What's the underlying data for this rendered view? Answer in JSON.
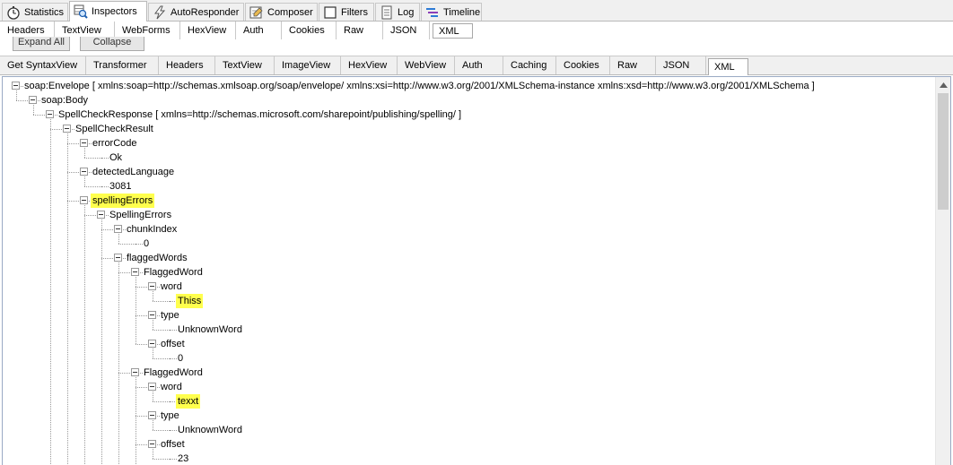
{
  "main_tabs": [
    {
      "label": "Statistics",
      "icon": "stopwatch-icon"
    },
    {
      "label": "Inspectors",
      "icon": "magnifier-grid-icon",
      "active": true
    },
    {
      "label": "AutoResponder",
      "icon": "lightning-icon"
    },
    {
      "label": "Composer",
      "icon": "edit-form-icon"
    },
    {
      "label": "Filters",
      "icon": "checkbox-icon"
    },
    {
      "label": "Log",
      "icon": "document-icon"
    },
    {
      "label": "Timeline",
      "icon": "timeline-bars-icon"
    }
  ],
  "request_tabs": [
    "Headers",
    "TextView",
    "WebForms",
    "HexView",
    "Auth",
    "Cookies",
    "Raw",
    "JSON",
    "XML"
  ],
  "request_active": "XML",
  "request_buttons": {
    "expand_all": "Expand All",
    "collapse": "Collapse"
  },
  "response_tabs": [
    "Get SyntaxView",
    "Transformer",
    "Headers",
    "TextView",
    "ImageView",
    "HexView",
    "WebView",
    "Auth",
    "Caching",
    "Cookies",
    "Raw",
    "JSON",
    "XML"
  ],
  "response_active": "XML",
  "tree": [
    {
      "text": "soap:Envelope [ xmlns:soap=http://schemas.xmlsoap.org/soap/envelope/ xmlns:xsi=http://www.w3.org/2001/XMLSchema-instance xmlns:xsd=http://www.w3.org/2001/XMLSchema ]",
      "depth": 0,
      "expandable": true
    },
    {
      "text": "soap:Body",
      "depth": 1,
      "expandable": true
    },
    {
      "text": "SpellCheckResponse [ xmlns=http://schemas.microsoft.com/sharepoint/publishing/spelling/ ]",
      "depth": 2,
      "expandable": true
    },
    {
      "text": "SpellCheckResult",
      "depth": 3,
      "expandable": true
    },
    {
      "text": "errorCode",
      "depth": 4,
      "expandable": true
    },
    {
      "text": "Ok",
      "depth": 5,
      "expandable": false
    },
    {
      "text": "detectedLanguage",
      "depth": 4,
      "expandable": true
    },
    {
      "text": "3081",
      "depth": 5,
      "expandable": false
    },
    {
      "text": "spellingErrors",
      "depth": 4,
      "expandable": true,
      "highlight": true
    },
    {
      "text": "SpellingErrors",
      "depth": 5,
      "expandable": true
    },
    {
      "text": "chunkIndex",
      "depth": 6,
      "expandable": true
    },
    {
      "text": "0",
      "depth": 7,
      "expandable": false
    },
    {
      "text": "flaggedWords",
      "depth": 6,
      "expandable": true
    },
    {
      "text": "FlaggedWord",
      "depth": 7,
      "expandable": true
    },
    {
      "text": "word",
      "depth": 8,
      "expandable": true
    },
    {
      "text": "Thiss",
      "depth": 9,
      "expandable": false,
      "highlight": true
    },
    {
      "text": "type",
      "depth": 8,
      "expandable": true
    },
    {
      "text": "UnknownWord",
      "depth": 9,
      "expandable": false
    },
    {
      "text": "offset",
      "depth": 8,
      "expandable": true
    },
    {
      "text": "0",
      "depth": 9,
      "expandable": false
    },
    {
      "text": "FlaggedWord",
      "depth": 7,
      "expandable": true
    },
    {
      "text": "word",
      "depth": 8,
      "expandable": true
    },
    {
      "text": "texxt",
      "depth": 9,
      "expandable": false,
      "highlight": true
    },
    {
      "text": "type",
      "depth": 8,
      "expandable": true
    },
    {
      "text": "UnknownWord",
      "depth": 9,
      "expandable": false
    },
    {
      "text": "offset",
      "depth": 8,
      "expandable": true
    },
    {
      "text": "23",
      "depth": 9,
      "expandable": false
    }
  ],
  "colors": {
    "highlight": "#ffff4d",
    "tree_border": "#9aaac4",
    "tab_bg": "#f0f0f0"
  }
}
